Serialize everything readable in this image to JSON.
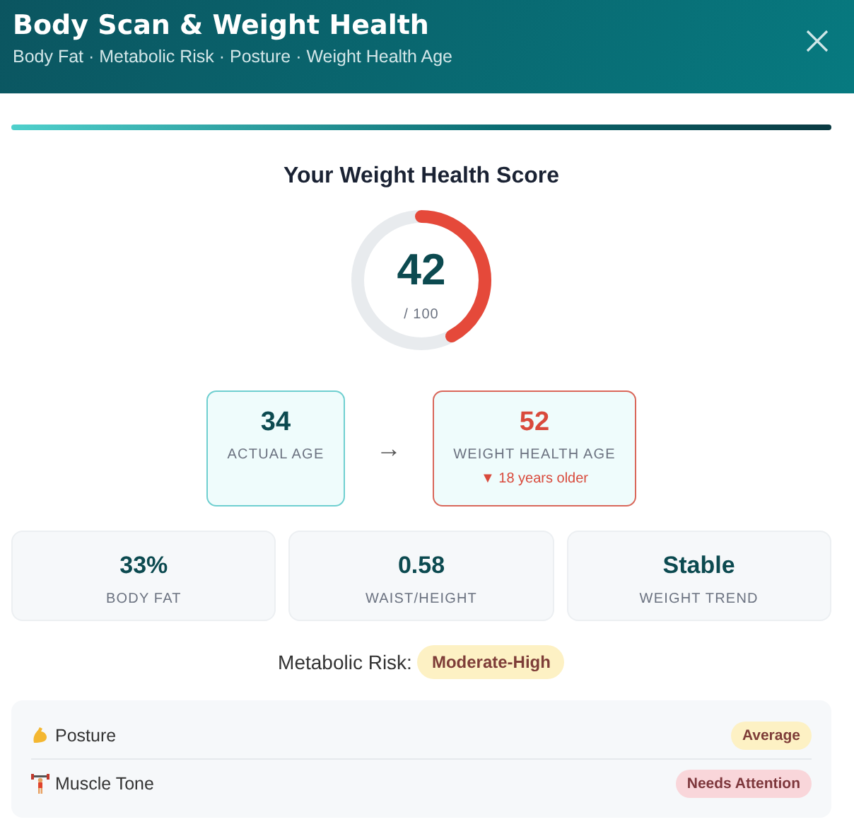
{
  "header": {
    "title": "Body Scan & Weight Health",
    "subtitle": "Body Fat · Metabolic Risk · Posture · Weight Health Age"
  },
  "score": {
    "title": "Your Weight Health Score",
    "value": "42",
    "scale": "/ 100",
    "level": 0.42
  },
  "ages": [
    {
      "kind": "actual",
      "value": "34",
      "label": "ACTUAL AGE"
    },
    {
      "kind": "health",
      "value": "52",
      "label": "WEIGHT HEALTH AGE",
      "note": "▼ 18 years older"
    }
  ],
  "arrow": "→",
  "stats": [
    {
      "value": "33%",
      "label": "BODY FAT"
    },
    {
      "value": "0.58",
      "label": "WAIST/HEIGHT"
    },
    {
      "value": "Stable",
      "label": "WEIGHT TREND"
    }
  ],
  "metabolic": {
    "label": "Metabolic Risk:",
    "badge": "Moderate-High",
    "color": "#fdf1c4"
  },
  "checks": [
    {
      "kind": "arm",
      "label": "Posture",
      "badge": "Average",
      "color": "#fdf1c4"
    },
    {
      "kind": "lifter",
      "label": "Muscle Tone",
      "badge": "Needs Attention",
      "color": "#f9d6da"
    }
  ]
}
